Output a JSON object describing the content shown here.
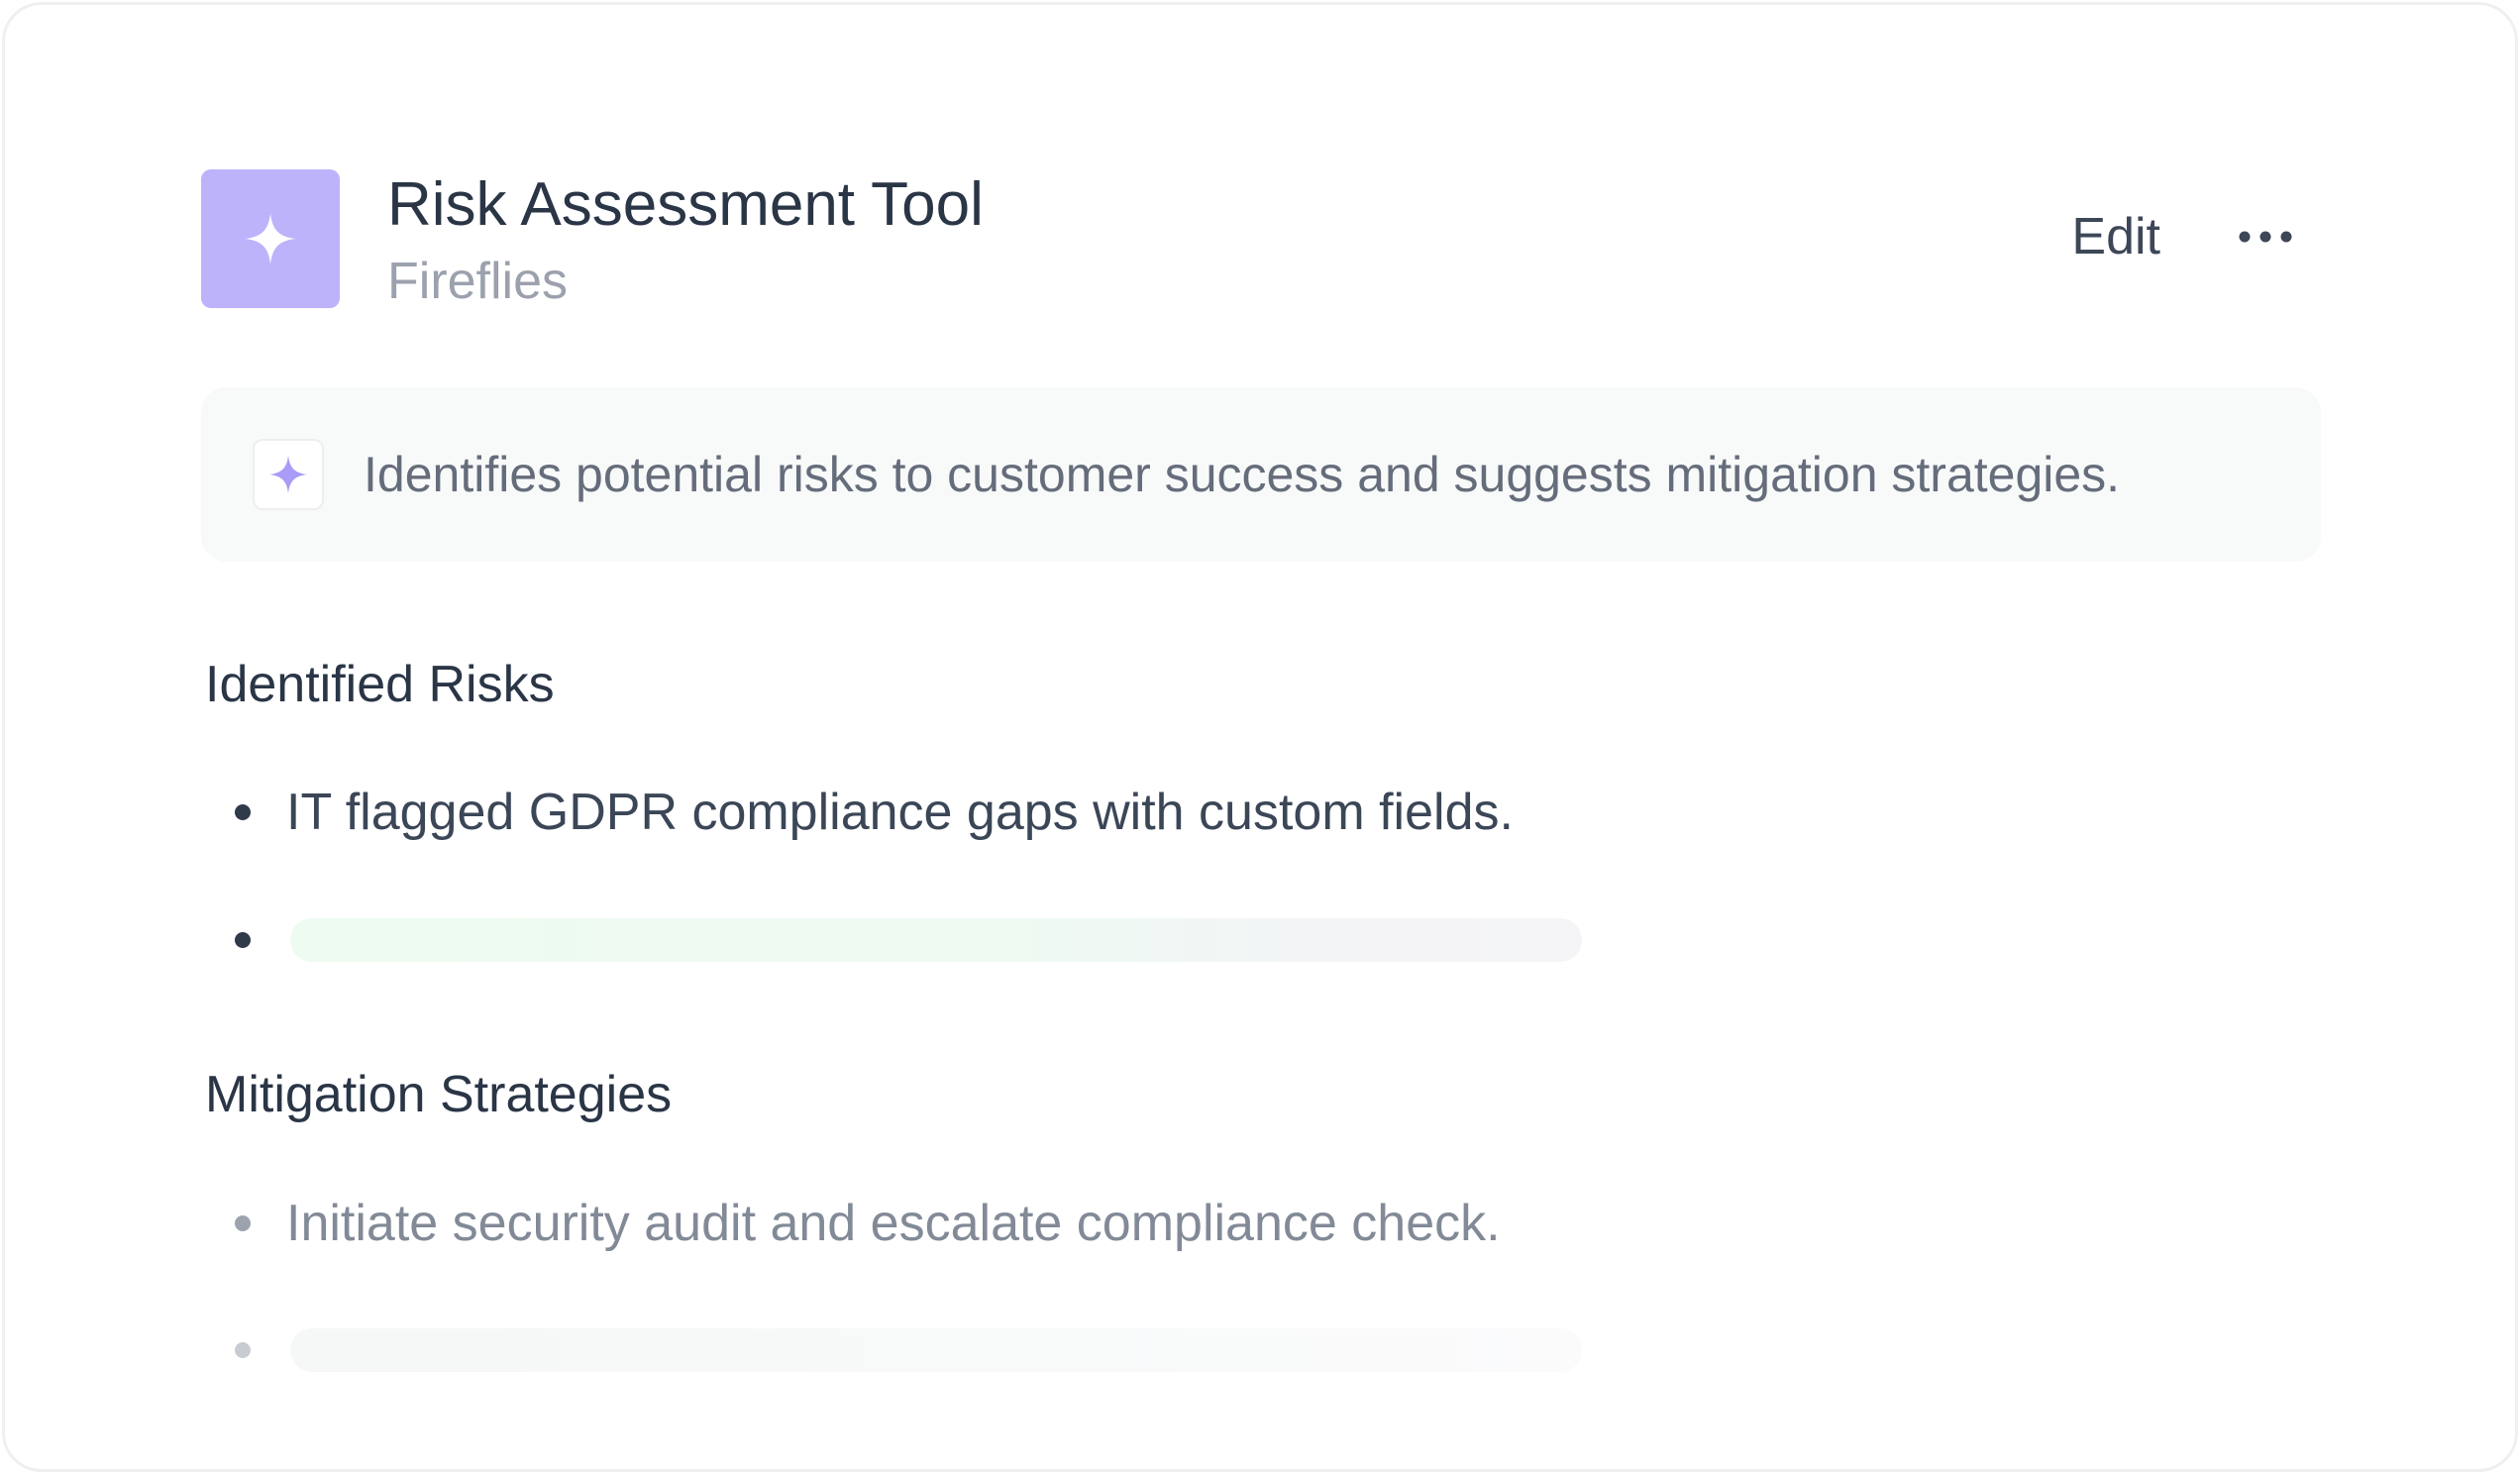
{
  "tool": {
    "title": "Risk Assessment Tool",
    "provider": "Fireflies",
    "icon": "sparkle-icon",
    "icon_bg": "#bdb3fb"
  },
  "actions": {
    "edit_label": "Edit",
    "more_icon": "more-horizontal-icon"
  },
  "description": {
    "icon": "sparkle-icon",
    "text": "Identifies potential risks to customer success and suggests mitigation strategies."
  },
  "sections": [
    {
      "heading": "Identified Risks",
      "items": [
        {
          "text": "IT flagged GDPR compliance gaps with custom fields."
        },
        {
          "loading": true
        }
      ]
    },
    {
      "heading": "Mitigation Strategies",
      "items": [
        {
          "text": "Initiate security audit and escalate compliance check."
        },
        {
          "loading": true
        }
      ]
    }
  ],
  "colors": {
    "text_primary": "#2a3546",
    "text_muted": "#7d8593",
    "accent": "#a99cf6"
  }
}
